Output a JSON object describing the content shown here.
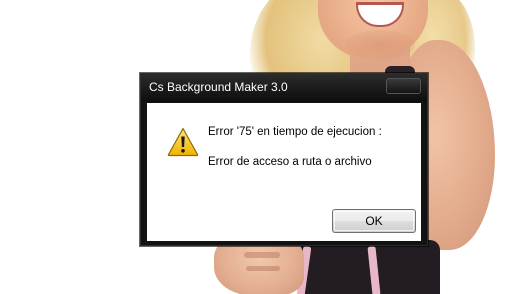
{
  "dialog": {
    "title": "Cs Background Maker 3.0",
    "icon": "warning-icon",
    "message_line1": "Error '75' en tiempo de ejecucion :",
    "message_line2": "Error de acceso a ruta o archivo",
    "ok_label": "OK",
    "colors": {
      "titlebar": "#1a1a1a",
      "title_text": "#ffffff",
      "client_bg": "#ffffff",
      "warning_fill": "#f5c518",
      "warning_border": "#8a6d00"
    }
  }
}
